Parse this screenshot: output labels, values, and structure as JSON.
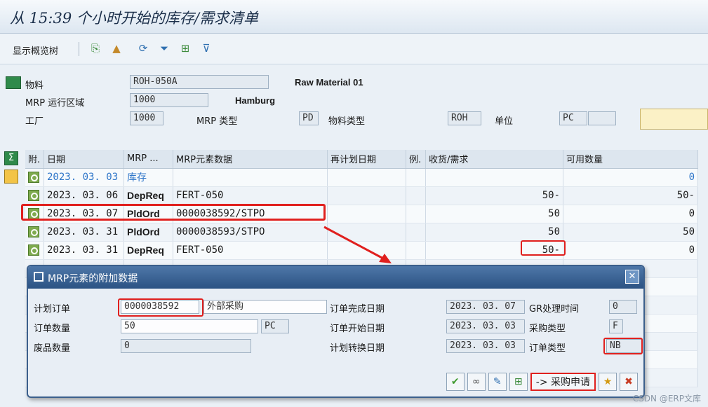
{
  "title": "从 15:39 个小时开始的库存/需求清单",
  "toolbar": {
    "label": "显示概览树"
  },
  "header": {
    "material_label": "物料",
    "material_value": "ROH-050A",
    "material_desc": "Raw Material 01",
    "mrp_area_label": "MRP 运行区域",
    "mrp_area_value": "1000",
    "mrp_area_desc": "Hamburg",
    "plant_label": "工厂",
    "plant_value": "1000",
    "mrp_type_label": "MRP 类型",
    "mrp_type_value": "PD",
    "mat_type_label": "物料类型",
    "mat_type_value": "ROH",
    "unit_label": "单位",
    "unit_value": "PC"
  },
  "table": {
    "headers": [
      "附.",
      "日期",
      "MRP ...",
      "MRP元素数据",
      "再计划日期",
      "例.",
      "收货/需求",
      "可用数量"
    ],
    "rows": [
      {
        "date": "2023. 03. 03",
        "elem": "库存",
        "data": "",
        "qty": "",
        "avail": "0",
        "blue": true
      },
      {
        "date": "2023. 03. 06",
        "elem": "DepReq",
        "data": "FERT-050",
        "qty": "50-",
        "avail": "50-",
        "blue": false
      },
      {
        "date": "2023. 03. 07",
        "elem": "PldOrd",
        "data": "0000038592/STPO",
        "qty": "50",
        "avail": "0",
        "blue": false
      },
      {
        "date": "2023. 03. 31",
        "elem": "PldOrd",
        "data": "0000038593/STPO",
        "qty": "50",
        "avail": "50",
        "blue": false
      },
      {
        "date": "2023. 03. 31",
        "elem": "DepReq",
        "data": "FERT-050",
        "qty": "50-",
        "avail": "0",
        "blue": false
      }
    ]
  },
  "dialog": {
    "title": "MRP元素的附加数据",
    "planned_order_label": "计划订单",
    "planned_order_value": "0000038592",
    "procurement_label": "外部采购",
    "order_qty_label": "订单数量",
    "order_qty_value": "50",
    "order_qty_unit": "PC",
    "scrap_label": "废品数量",
    "scrap_value": "0",
    "finish_date_label": "订单完成日期",
    "finish_date_value": "2023. 03. 07",
    "gr_time_label": "GR处理时间",
    "gr_time_value": "0",
    "start_date_label": "订单开始日期",
    "start_date_value": "2023. 03. 03",
    "proc_type_label": "采购类型",
    "proc_type_value": "F",
    "conv_date_label": "计划转换日期",
    "conv_date_value": "2023. 03. 03",
    "order_type_label": "订单类型",
    "order_type_value": "NB",
    "pr_button_label": "-> 采购申请"
  },
  "watermark": "CSDN @ERP文库"
}
